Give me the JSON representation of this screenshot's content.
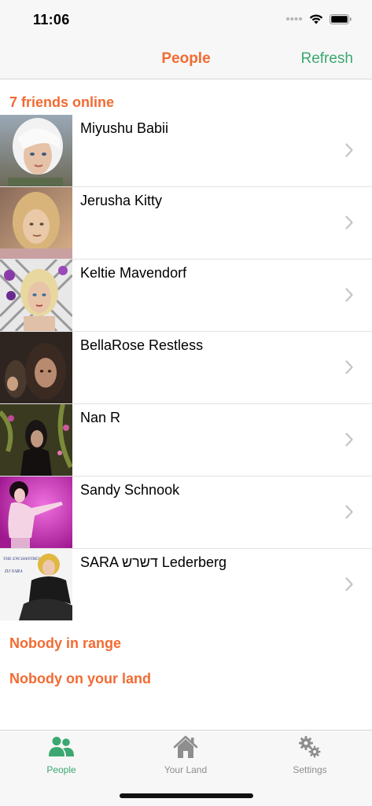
{
  "status_bar": {
    "time": "11:06"
  },
  "nav": {
    "title": "People",
    "refresh_label": "Refresh"
  },
  "sections": {
    "online_header": "7 friends online",
    "range_header": "Nobody in range",
    "land_header": "Nobody on your land"
  },
  "friends": [
    {
      "name": "Miyushu Babii"
    },
    {
      "name": "Jerusha Kitty"
    },
    {
      "name": "Keltie Mavendorf"
    },
    {
      "name": "BellaRose Restless"
    },
    {
      "name": "Nan R"
    },
    {
      "name": "Sandy Schnook"
    },
    {
      "name": "SARA דשרש Lederberg"
    }
  ],
  "avatar_caption": {
    "line1": "THE ENCHANTRESS",
    "line2": "DJ SARA"
  },
  "tabs": [
    {
      "label": "People",
      "icon": "people-icon",
      "selected": true
    },
    {
      "label": "Your Land",
      "icon": "house-icon",
      "selected": false
    },
    {
      "label": "Settings",
      "icon": "gears-icon",
      "selected": false
    }
  ],
  "colors": {
    "accent_orange": "#f26b32",
    "accent_green": "#3aa870",
    "tab_inactive": "#8e8e8e"
  }
}
